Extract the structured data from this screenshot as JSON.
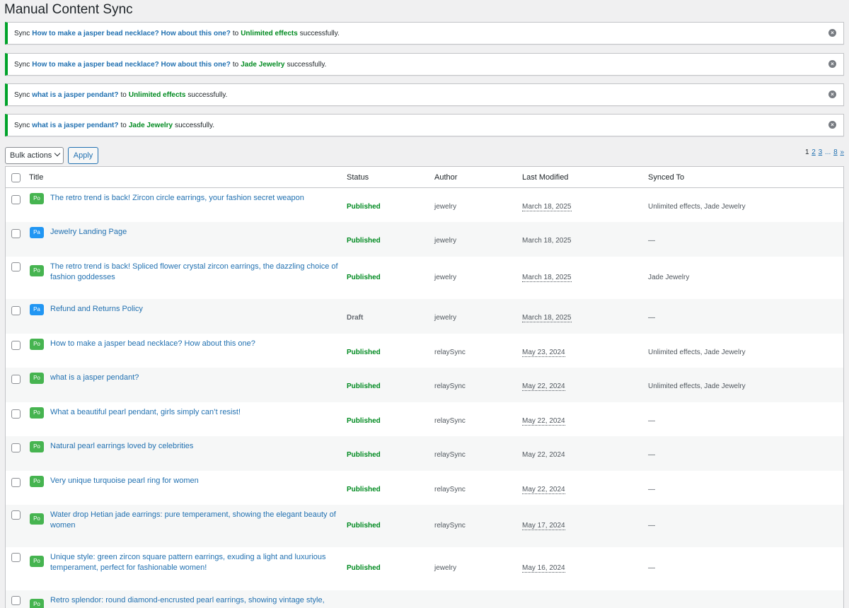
{
  "page": {
    "title": "Manual Content Sync"
  },
  "notices": [
    {
      "prefix": "Sync",
      "post": "How to make a jasper bead necklace? How about this one?",
      "mid": "to",
      "site": "Unlimited effects",
      "suffix": "successfully."
    },
    {
      "prefix": "Sync",
      "post": "How to make a jasper bead necklace? How about this one?",
      "mid": "to",
      "site": "Jade Jewelry",
      "suffix": "successfully."
    },
    {
      "prefix": "Sync",
      "post": "what is a jasper pendant?",
      "mid": "to",
      "site": "Unlimited effects",
      "suffix": "successfully."
    },
    {
      "prefix": "Sync",
      "post": "what is a jasper pendant?",
      "mid": "to",
      "site": "Jade Jewelry",
      "suffix": "successfully."
    }
  ],
  "toolbar": {
    "bulk_actions": "Bulk actions",
    "apply": "Apply"
  },
  "pagination": {
    "p1": "1",
    "p2": "2",
    "p3": "3",
    "ellipsis": "...",
    "p8": "8",
    "next": "»"
  },
  "table": {
    "headers": {
      "title": "Title",
      "status": "Status",
      "author": "Author",
      "modified": "Last Modified",
      "synced": "Synced To"
    },
    "rows": [
      {
        "type": "Po",
        "title": "The retro trend is back! Zircon circle earrings, your fashion secret weapon",
        "status": "Published",
        "author": "jewelry",
        "date": "March 18, 2025",
        "synced": "Unlimited effects, Jade Jewelry"
      },
      {
        "type": "Pa",
        "title": "Jewelry Landing Page",
        "status": "Published",
        "author": "jewelry",
        "date": "March 18, 2025",
        "synced": "—"
      },
      {
        "type": "Po",
        "title": "The retro trend is back! Spliced flower crystal zircon earrings, the dazzling choice of fashion goddesses",
        "status": "Published",
        "author": "jewelry",
        "date": "March 18, 2025",
        "synced": "Jade Jewelry"
      },
      {
        "type": "Pa",
        "title": "Refund and Returns Policy",
        "status": "Draft",
        "author": "jewelry",
        "date": "March 18, 2025",
        "synced": "—"
      },
      {
        "type": "Po",
        "title": "How to make a jasper bead necklace? How about this one?",
        "status": "Published",
        "author": "relaySync",
        "date": "May 23, 2024",
        "synced": "Unlimited effects, Jade Jewelry"
      },
      {
        "type": "Po",
        "title": "what is a jasper pendant?",
        "status": "Published",
        "author": "relaySync",
        "date": "May 22, 2024",
        "synced": "Unlimited effects, Jade Jewelry"
      },
      {
        "type": "Po",
        "title": "What a beautiful pearl pendant, girls simply can’t resist!",
        "status": "Published",
        "author": "relaySync",
        "date": "May 22, 2024",
        "synced": "—"
      },
      {
        "type": "Po",
        "title": "Natural pearl earrings loved by celebrities",
        "status": "Published",
        "author": "relaySync",
        "date": "May 22, 2024",
        "synced": "—"
      },
      {
        "type": "Po",
        "title": "Very unique turquoise pearl ring for women",
        "status": "Published",
        "author": "relaySync",
        "date": "May 22, 2024",
        "synced": "—"
      },
      {
        "type": "Po",
        "title": "Water drop Hetian jade earrings: pure temperament, showing the elegant beauty of women",
        "status": "Published",
        "author": "relaySync",
        "date": "May 17, 2024",
        "synced": "—"
      },
      {
        "type": "Po",
        "title": "Unique style: green zircon square pattern earrings, exuding a light and luxurious temperament, perfect for fashionable women!",
        "status": "Published",
        "author": "jewelry",
        "date": "May 16, 2024",
        "synced": "—"
      },
      {
        "type": "Po",
        "title": "Retro splendor: round diamond-encrusted pearl earrings, showing vintage style,",
        "status": "",
        "author": "",
        "date": "",
        "synced": ""
      }
    ]
  },
  "colors": {
    "accent": "#2271b1",
    "success": "#00a32a",
    "post_badge": "#46b450",
    "page_badge": "#2196f3"
  }
}
